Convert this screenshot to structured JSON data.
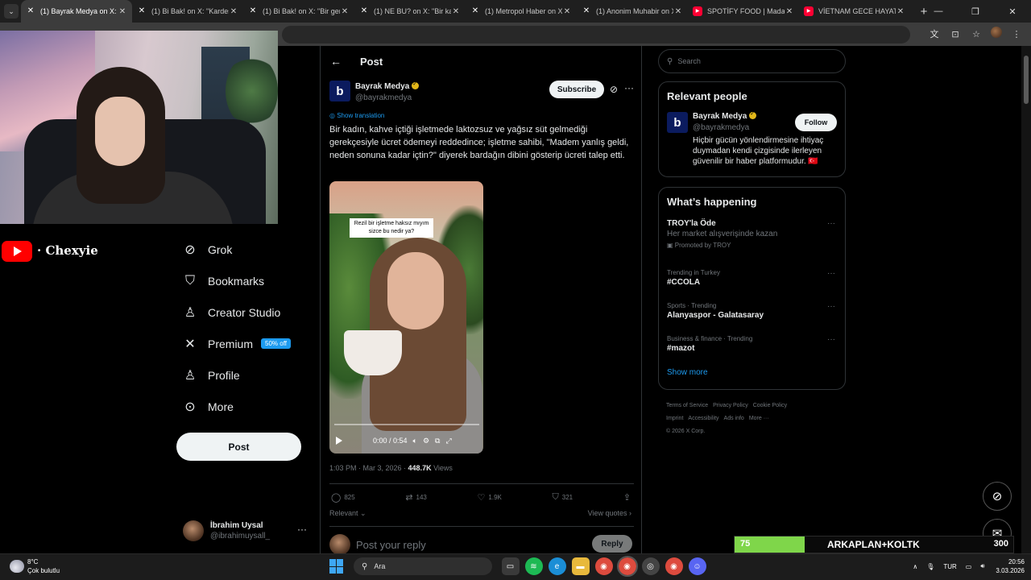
{
  "browser": {
    "tabs": [
      {
        "title": "(1) Bayrak Medya on X: \"Bir kadın",
        "favicon": "x",
        "active": true
      },
      {
        "title": "(1) Bi Bak! on X: \"Kardeşim",
        "favicon": "x",
        "active": false
      },
      {
        "title": "(1) Bi Bak! on X: \"Bir genç",
        "favicon": "x",
        "active": false
      },
      {
        "title": "(1) NE BU? on X: \"Bir kadın",
        "favicon": "x",
        "active": false
      },
      {
        "title": "(1) Metropol Haber on X:",
        "favicon": "x",
        "active": false
      },
      {
        "title": "(1) Anonim Muhabir on X:",
        "favicon": "x",
        "active": false
      },
      {
        "title": "SPOTİFY FOOD | Madara",
        "favicon": "youtube",
        "active": false
      },
      {
        "title": "VİETNAM GECE HAYATI B",
        "favicon": "youtube",
        "active": false
      }
    ],
    "new_tab": "+",
    "window_controls": [
      "—",
      "❐",
      "✕"
    ]
  },
  "overlay": {
    "channel_name": "· Chexyie",
    "goal": {
      "current": "75",
      "label": "ARKAPLAN+KOLTK",
      "target": "300",
      "progress": 0.25,
      "fill_color": "#7fd64a"
    }
  },
  "nav": {
    "items": [
      {
        "label": "Grok",
        "icon": "grok-icon",
        "glyph": "⊘"
      },
      {
        "label": "Bookmarks",
        "icon": "bookmark-icon",
        "glyph": "⛉"
      },
      {
        "label": "Creator Studio",
        "icon": "creator-studio-icon",
        "glyph": "♙"
      },
      {
        "label": "Premium",
        "icon": "x-logo-icon",
        "glyph": "✕",
        "badge": "50% off"
      },
      {
        "label": "Profile",
        "icon": "profile-icon",
        "glyph": "♙"
      },
      {
        "label": "More",
        "icon": "more-circle-icon",
        "glyph": "⊙"
      }
    ],
    "post_button": "Post",
    "account": {
      "name": "İbrahim Uysal",
      "handle": "@ibrahimuysall_"
    }
  },
  "post": {
    "header_title": "Post",
    "author": {
      "name": "Bayrak Medya",
      "handle": "@bayrakmedya",
      "logo_letter": "b"
    },
    "subscribe_label": "Subscribe",
    "show_translation": "Show translation",
    "text": "Bir kadın, kahve içtiği işletmede laktozsuz ve yağsız süt gelmediği gerekçesiyle ücret ödemeyi reddedince; işletme sahibi, \"Madem yanlış geldi, neden sonuna kadar içtin?\" diyerek bardağın dibini gösterip ücreti talep etti.",
    "video": {
      "caption": "Rezil bir işletme haksız mıyım sizce bu nedir ya?",
      "time": "0:00 / 0:54"
    },
    "timestamp": "1:03 PM · Mar 3, 2026 · ",
    "views_count": "448.7K",
    "views_label": " Views",
    "stats": {
      "replies": "825",
      "reposts": "143",
      "likes": "1.9K",
      "bookmarks": "321"
    },
    "relevant_label": "Relevant ⌄",
    "view_quotes": "View quotes ›",
    "reply_placeholder": "Post your reply",
    "reply_button": "Reply"
  },
  "sidebar": {
    "search_placeholder": "Search",
    "relevant_people": {
      "title": "Relevant people",
      "name": "Bayrak Medya",
      "handle": "@bayrakmedya",
      "logo_letter": "b",
      "bio": "Hiçbir gücün yönlendirmesine ihtiyaç duymadan kendi çizgisinde ilerleyen güvenilir bir haber platformudur. 🇹🇷",
      "follow_label": "Follow"
    },
    "whats_happening": {
      "title": "What’s happening",
      "promoted": {
        "name": "TROY'la Öde",
        "sub": "Her market alışverişinde kazan",
        "promo": "Promoted by TROY"
      },
      "trends": [
        {
          "context": "Trending in Turkey",
          "name": "#CCOLA"
        },
        {
          "context": "Sports · Trending",
          "name": "Alanyaspor - Galatasaray"
        },
        {
          "context": "Business & finance · Trending",
          "name": "#mazot"
        }
      ],
      "show_more": "Show more"
    },
    "footer": {
      "links": [
        "Terms of Service",
        "Privacy Policy",
        "Cookie Policy",
        "Imprint",
        "Accessibility",
        "Ads info",
        "More ···"
      ],
      "copyright": "© 2026 X Corp."
    }
  },
  "taskbar": {
    "weather_temp": "8°C",
    "weather_desc": "Çok bulutlu",
    "search_label": "Ara",
    "language": "TUR",
    "time": "20:56",
    "date": "3.03.2026"
  }
}
